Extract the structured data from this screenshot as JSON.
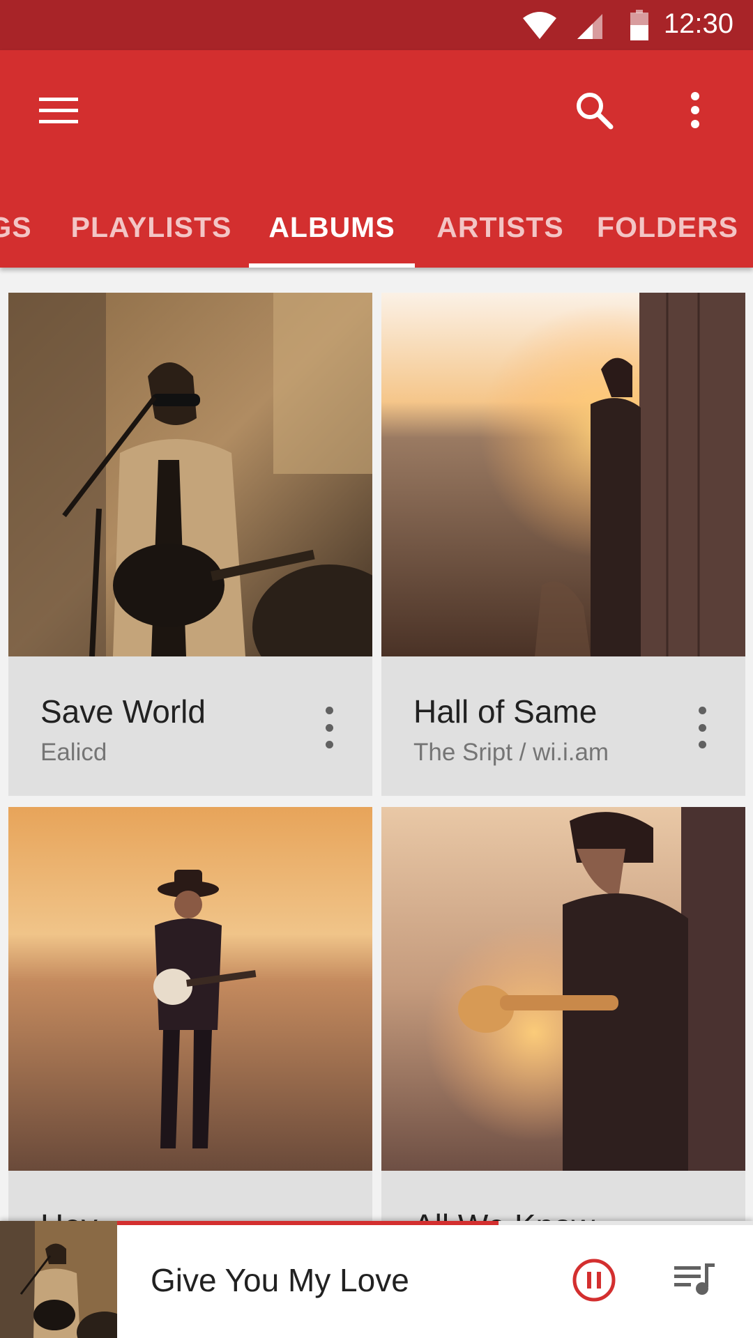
{
  "status_bar": {
    "time": "12:30"
  },
  "app_bar": {
    "menu_icon": "menu-icon",
    "search_icon": "search-icon",
    "more_icon": "more-vert-icon",
    "color": "#d32f2f",
    "status_color": "#a82428"
  },
  "tabs": [
    {
      "label": "GS"
    },
    {
      "label": "PLAYLISTS"
    },
    {
      "label": "ALBUMS"
    },
    {
      "label": "ARTISTS"
    },
    {
      "label": "FOLDERS"
    }
  ],
  "selected_tab": "ALBUMS",
  "albums": [
    {
      "title": "Save World",
      "artist": "Ealicd"
    },
    {
      "title": "Hall of Same",
      "artist": "The Sript / wi.i.am"
    },
    {
      "title": "Hey",
      "artist": ""
    },
    {
      "title": "All We Know",
      "artist": ""
    }
  ],
  "now_playing": {
    "song": "Give You My Love",
    "progress": 0.6,
    "pause_icon": "pause-circle-icon",
    "queue_icon": "queue-music-icon",
    "accent": "#d32f2f"
  }
}
